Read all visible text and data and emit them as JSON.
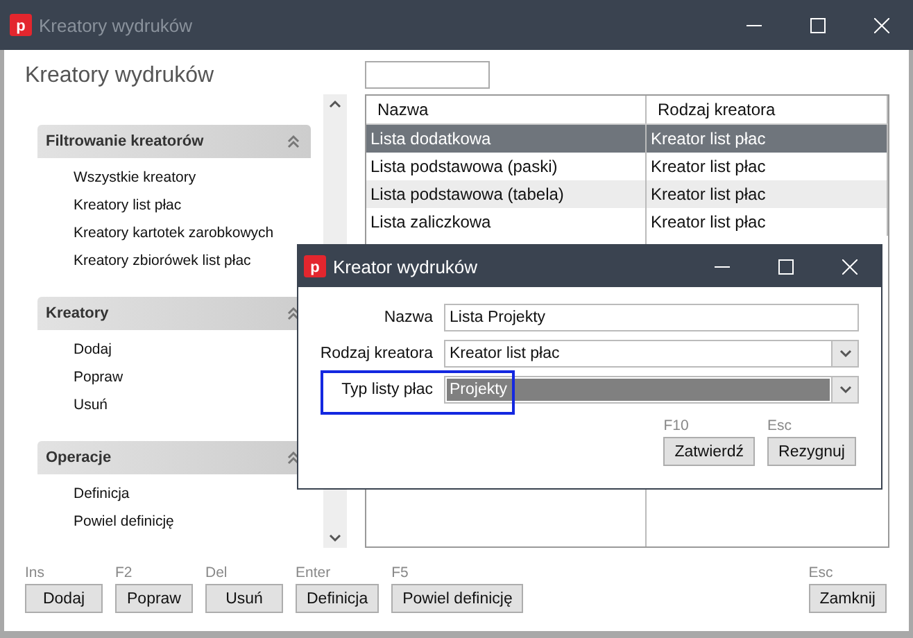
{
  "window": {
    "logo": "p",
    "title": "Kreatory wydruków"
  },
  "heading": "Kreatory wydruków",
  "sidebar": {
    "sections": [
      {
        "title": "Filtrowanie kreatorów",
        "expanded": true,
        "items": [
          "Wszystkie kreatory",
          "Kreatory list płac",
          "Kreatory kartotek zarobkowych",
          "Kreatory zbiorówek list płac"
        ]
      },
      {
        "title": "Kreatory",
        "expanded": true,
        "items": [
          "Dodaj",
          "Popraw",
          "Usuń"
        ]
      },
      {
        "title": "Operacje",
        "expanded": true,
        "items": [
          "Definicja",
          "Powiel definicję"
        ]
      }
    ]
  },
  "table": {
    "columns": [
      "Nazwa",
      "Rodzaj kreatora"
    ],
    "rows": [
      {
        "cells": [
          "Lista dodatkowa",
          "Kreator list płac"
        ],
        "selected": true
      },
      {
        "cells": [
          "Lista podstawowa (paski)",
          "Kreator list płac"
        ],
        "selected": false
      },
      {
        "cells": [
          "Lista podstawowa (tabela)",
          "Kreator list płac"
        ],
        "selected": false
      },
      {
        "cells": [
          "Lista zaliczkowa",
          "Kreator list płac"
        ],
        "selected": false
      }
    ]
  },
  "buttons": [
    {
      "key": "Ins",
      "label": "Dodaj"
    },
    {
      "key": "F2",
      "label": "Popraw"
    },
    {
      "key": "Del",
      "label": "Usuń"
    },
    {
      "key": "Enter",
      "label": "Definicja"
    },
    {
      "key": "F5",
      "label": "Powiel definicję"
    }
  ],
  "close_button": {
    "key": "Esc",
    "label": "Zamknij"
  },
  "dialog": {
    "logo": "p",
    "title": "Kreator wydruków",
    "fields": [
      {
        "kind": "text",
        "label": "Nazwa",
        "value": "Lista Projekty",
        "focused": false
      },
      {
        "kind": "select",
        "label": "Rodzaj kreatora",
        "value": "Kreator list płac",
        "focused": false
      },
      {
        "kind": "select",
        "label": "Typ listy płac",
        "value": "Projekty",
        "focused": true
      }
    ],
    "buttons": [
      {
        "key": "F10",
        "label": "Zatwierdź"
      },
      {
        "key": "Esc",
        "label": "Rezygnuj"
      }
    ]
  }
}
